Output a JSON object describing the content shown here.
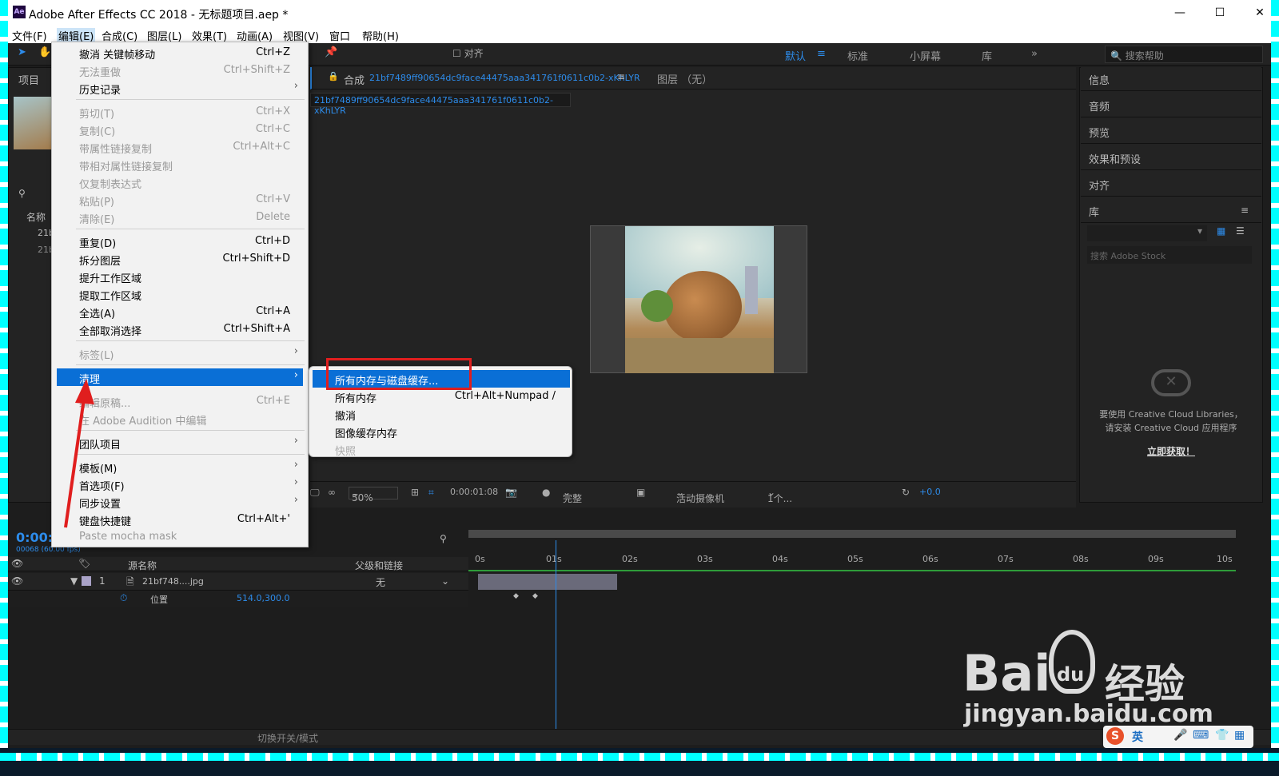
{
  "window": {
    "app_logo": "Ae",
    "title": "Adobe After Effects CC 2018 - 无标题项目.aep *",
    "min": "—",
    "max": "☐",
    "close": "✕"
  },
  "menubar": [
    "文件(F)",
    "编辑(E)",
    "合成(C)",
    "图层(L)",
    "效果(T)",
    "动画(A)",
    "视图(V)",
    "窗口",
    "帮助(H)"
  ],
  "toolbar": {
    "align_label": "对齐",
    "workspaces": [
      "默认",
      "标准",
      "小屏幕",
      "库"
    ],
    "search_placeholder": "搜索帮助",
    "overflow": "»"
  },
  "project_panel": {
    "tab": "项目",
    "name_col": "名称",
    "item1": "21b",
    "item2": "21b"
  },
  "composition": {
    "tab_label": "合成",
    "comp_name": "21bf7489ff90654dc9face44475aaa341761f0611c0b2-xKhLYR",
    "sub_name": "21bf7489ff90654dc9face44475aaa341761f0611c0b2-xKhLYR",
    "layer_tab": "图层 （无）",
    "zoom": "50%",
    "timecode": "0:00:01:08",
    "quality": "完整",
    "camera": "活动摄像机",
    "views": "1个...",
    "exposure": "+0.0"
  },
  "right_panels": [
    "信息",
    "音频",
    "预览",
    "效果和预设",
    "对齐",
    "库"
  ],
  "library": {
    "search_placeholder": "搜索 Adobe Stock",
    "notice_line1": "要使用 Creative Cloud Libraries，",
    "notice_line2": "请安装 Creative Cloud 应用程序",
    "link": "立即获取！"
  },
  "timeline": {
    "timecode": "0:00:",
    "fps": "00068 (60.00 fps)",
    "col_source": "源名称",
    "col_parent": "父级和链接",
    "layer_num": "1",
    "layer_name": "21bf748....jpg",
    "parent_value": "无",
    "prop_name": "位置",
    "prop_value": "514.0,300.0",
    "ruler": [
      "0s",
      "01s",
      "02s",
      "03s",
      "04s",
      "05s",
      "06s",
      "07s",
      "08s",
      "09s",
      "10s"
    ],
    "toggle_label": "切换开关/模式"
  },
  "edit_menu": [
    {
      "label": "撤消 关键帧移动",
      "shortcut": "Ctrl+Z",
      "disabled": false
    },
    {
      "label": "无法重做",
      "shortcut": "Ctrl+Shift+Z",
      "disabled": true
    },
    {
      "label": "历史记录",
      "shortcut": "",
      "disabled": false,
      "submenu": true
    },
    {
      "label": "剪切(T)",
      "shortcut": "Ctrl+X",
      "disabled": true
    },
    {
      "label": "复制(C)",
      "shortcut": "Ctrl+C",
      "disabled": true
    },
    {
      "label": "带属性链接复制",
      "shortcut": "Ctrl+Alt+C",
      "disabled": true
    },
    {
      "label": "带相对属性链接复制",
      "shortcut": "",
      "disabled": true
    },
    {
      "label": "仅复制表达式",
      "shortcut": "",
      "disabled": true
    },
    {
      "label": "粘贴(P)",
      "shortcut": "Ctrl+V",
      "disabled": true
    },
    {
      "label": "清除(E)",
      "shortcut": "Delete",
      "disabled": true
    },
    {
      "label": "重复(D)",
      "shortcut": "Ctrl+D",
      "disabled": false
    },
    {
      "label": "拆分图层",
      "shortcut": "Ctrl+Shift+D",
      "disabled": false
    },
    {
      "label": "提升工作区域",
      "shortcut": "",
      "disabled": false
    },
    {
      "label": "提取工作区域",
      "shortcut": "",
      "disabled": false
    },
    {
      "label": "全选(A)",
      "shortcut": "Ctrl+A",
      "disabled": false
    },
    {
      "label": "全部取消选择",
      "shortcut": "Ctrl+Shift+A",
      "disabled": false
    },
    {
      "label": "标签(L)",
      "shortcut": "",
      "disabled": true,
      "submenu": true
    },
    {
      "label": "清理",
      "shortcut": "",
      "disabled": false,
      "submenu": true,
      "highlighted": true
    },
    {
      "label": "编辑原稿...",
      "shortcut": "Ctrl+E",
      "disabled": true
    },
    {
      "label": "在 Adobe Audition 中编辑",
      "shortcut": "",
      "disabled": true
    },
    {
      "label": "团队项目",
      "shortcut": "",
      "disabled": false,
      "submenu": true
    },
    {
      "label": "模板(M)",
      "shortcut": "",
      "disabled": false,
      "submenu": true
    },
    {
      "label": "首选项(F)",
      "shortcut": "",
      "disabled": false,
      "submenu": true
    },
    {
      "label": "同步设置",
      "shortcut": "",
      "disabled": false,
      "submenu": true
    },
    {
      "label": "键盘快捷键",
      "shortcut": "Ctrl+Alt+'",
      "disabled": false
    },
    {
      "label": "Paste mocha mask",
      "shortcut": "",
      "disabled": true
    }
  ],
  "purge_submenu": [
    {
      "label": "所有内存与磁盘缓存...",
      "shortcut": "",
      "highlighted": true
    },
    {
      "label": "所有内存",
      "shortcut": "Ctrl+Alt+Numpad /"
    },
    {
      "label": "撤消",
      "shortcut": ""
    },
    {
      "label": "图像缓存内存",
      "shortcut": ""
    },
    {
      "label": "快照",
      "shortcut": "",
      "disabled": true
    }
  ],
  "watermark": {
    "brand": "Bai",
    "brand2": "du",
    "brand_cn": "经验",
    "url": "jingyan.baidu.com"
  },
  "ime": {
    "lang": "英"
  },
  "colors": {
    "accent": "#2d8ceb",
    "menu_highlight": "#0a6fd6",
    "annotation": "#e01e1e",
    "border_dash": "#00ffff"
  }
}
